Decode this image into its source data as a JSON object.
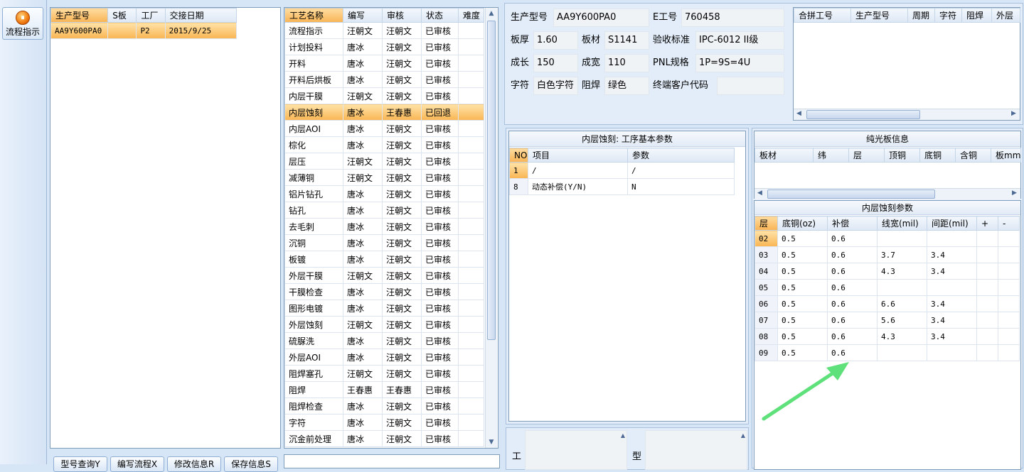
{
  "sidebar": {
    "nav_label": "流程指示",
    "nav_icon": "process-icon"
  },
  "models": {
    "columns": [
      "生产型号",
      "S板",
      "工厂",
      "交接日期"
    ],
    "rows": [
      [
        "AA9Y600PA0",
        "",
        "P2",
        "2015/9/25"
      ]
    ]
  },
  "process": {
    "columns": [
      "工艺名称",
      "编写",
      "审核",
      "状态",
      "难度"
    ],
    "rows": [
      [
        "流程指示",
        "汪朝文",
        "汪朝文",
        "已审核",
        ""
      ],
      [
        "计划投料",
        "唐冰",
        "汪朝文",
        "已审核",
        ""
      ],
      [
        "开料",
        "唐冰",
        "汪朝文",
        "已审核",
        ""
      ],
      [
        "开料后烘板",
        "唐冰",
        "汪朝文",
        "已审核",
        ""
      ],
      [
        "内层干膜",
        "汪朝文",
        "汪朝文",
        "已审核",
        ""
      ],
      [
        "内层蚀刻",
        "唐冰",
        "王春惠",
        "已回退",
        ""
      ],
      [
        "内层AOI",
        "唐冰",
        "汪朝文",
        "已审核",
        ""
      ],
      [
        "棕化",
        "唐冰",
        "汪朝文",
        "已审核",
        ""
      ],
      [
        "层压",
        "汪朝文",
        "汪朝文",
        "已审核",
        ""
      ],
      [
        "减薄铜",
        "汪朝文",
        "汪朝文",
        "已审核",
        ""
      ],
      [
        "铝片钻孔",
        "唐冰",
        "汪朝文",
        "已审核",
        ""
      ],
      [
        "钻孔",
        "唐冰",
        "汪朝文",
        "已审核",
        ""
      ],
      [
        "去毛刺",
        "唐冰",
        "汪朝文",
        "已审核",
        ""
      ],
      [
        "沉铜",
        "唐冰",
        "汪朝文",
        "已审核",
        ""
      ],
      [
        "板镀",
        "唐冰",
        "汪朝文",
        "已审核",
        ""
      ],
      [
        "外层干膜",
        "汪朝文",
        "汪朝文",
        "已审核",
        ""
      ],
      [
        "干膜检查",
        "唐冰",
        "汪朝文",
        "已审核",
        ""
      ],
      [
        "图形电镀",
        "唐冰",
        "汪朝文",
        "已审核",
        ""
      ],
      [
        "外层蚀刻",
        "汪朝文",
        "汪朝文",
        "已审核",
        ""
      ],
      [
        "硫脲洗",
        "唐冰",
        "汪朝文",
        "已审核",
        ""
      ],
      [
        "外层AOI",
        "唐冰",
        "汪朝文",
        "已审核",
        ""
      ],
      [
        "阻焊塞孔",
        "汪朝文",
        "汪朝文",
        "已审核",
        ""
      ],
      [
        "阻焊",
        "王春惠",
        "王春惠",
        "已审核",
        ""
      ],
      [
        "阻焊检查",
        "唐冰",
        "汪朝文",
        "已审核",
        ""
      ],
      [
        "字符",
        "唐冰",
        "汪朝文",
        "已审核",
        ""
      ],
      [
        "沉金前处理",
        "唐冰",
        "汪朝文",
        "已审核",
        ""
      ]
    ],
    "selected": 5
  },
  "buttons": [
    "型号查询Y",
    "编写流程X",
    "修改信息R",
    "保存信息S"
  ],
  "info": {
    "model_label": "生产型号",
    "model": "AA9Y600PA0",
    "e_label": "E工号",
    "e": "760458",
    "thickness_label": "板厚",
    "thickness": "1.60",
    "material_label": "板材",
    "material": "S1141",
    "standard_label": "验收标准",
    "standard": "IPC-6012 II级",
    "len_label": "成长",
    "len": "150",
    "width_label": "成宽",
    "width": "110",
    "pnl_label": "PNL规格",
    "pnl": "1P=9S=4U",
    "char_label": "字符",
    "char": "白色字符",
    "mask_label": "阻焊",
    "mask": "绿色",
    "client_label": "终端客户代码",
    "client": ""
  },
  "combine": {
    "columns": [
      "合拼工号",
      "生产型号",
      "周期",
      "字符",
      "阻焊",
      "外层"
    ]
  },
  "basic_params": {
    "title": "内层蚀刻: 工序基本参数",
    "columns": [
      "NO",
      "项目",
      "参数"
    ],
    "rows": [
      [
        "1",
        "/",
        "/"
      ],
      [
        "8",
        "动态补偿(Y/N)",
        "N"
      ]
    ]
  },
  "pure_board": {
    "title": "纯光板信息",
    "columns": [
      "板材",
      "纬",
      "层",
      "顶铜",
      "底铜",
      "含铜",
      "板mm"
    ]
  },
  "etch_params": {
    "title": "内层蚀刻参数",
    "columns": [
      "层",
      "底铜(oz)",
      "补偿",
      "线宽(mil)",
      "间距(mil)",
      "+",
      "-"
    ],
    "rows": [
      [
        "02",
        "0.5",
        "0.6",
        "",
        "",
        "",
        ""
      ],
      [
        "03",
        "0.5",
        "0.6",
        "3.7",
        "3.4",
        "",
        ""
      ],
      [
        "04",
        "0.5",
        "0.6",
        "4.3",
        "3.4",
        "",
        ""
      ],
      [
        "05",
        "0.5",
        "0.6",
        "",
        "",
        "",
        ""
      ],
      [
        "06",
        "0.5",
        "0.6",
        "6.6",
        "3.4",
        "",
        ""
      ],
      [
        "07",
        "0.5",
        "0.6",
        "5.6",
        "3.4",
        "",
        ""
      ],
      [
        "08",
        "0.5",
        "0.6",
        "4.3",
        "3.4",
        "",
        ""
      ],
      [
        "09",
        "0.5",
        "0.6",
        "",
        "",
        "",
        ""
      ]
    ]
  },
  "bottom": {
    "work_label": "工",
    "type_label": "型"
  },
  "colors": {
    "highlight": "#f9b553",
    "arrow": "#5ee07a",
    "panel_bg": "#d7e6f7"
  }
}
